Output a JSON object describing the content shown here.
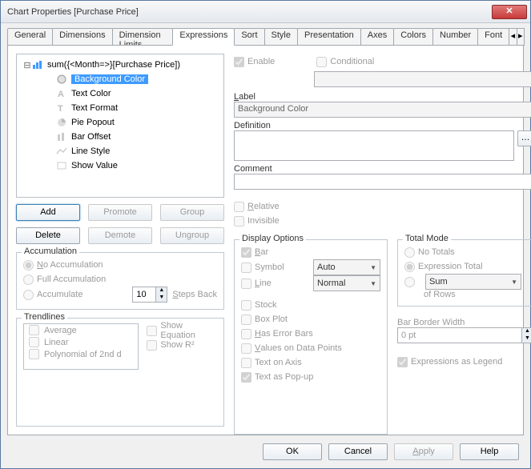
{
  "title": "Chart Properties [Purchase Price]",
  "tabs": [
    "General",
    "Dimensions",
    "Dimension Limits",
    "Expressions",
    "Sort",
    "Style",
    "Presentation",
    "Axes",
    "Colors",
    "Number",
    "Font"
  ],
  "activeTab": 3,
  "tree": {
    "root": "sum({<Month=>}[Purchase Price])",
    "children": [
      "Background Color",
      "Text Color",
      "Text Format",
      "Pie Popout",
      "Bar Offset",
      "Line Style",
      "Show Value"
    ],
    "selectedIndex": 0
  },
  "buttons": {
    "add": "Add",
    "promote": "Promote",
    "group": "Group",
    "delete": "Delete",
    "demote": "Demote",
    "ungroup": "Ungroup"
  },
  "accumulation": {
    "legend": "Accumulation",
    "noAcc": "No Accumulation",
    "fullAcc": "Full Accumulation",
    "acc": "Accumulate",
    "stepsVal": "10",
    "stepsBack": "Steps Back"
  },
  "trendlines": {
    "legend": "Trendlines",
    "items": [
      "Average",
      "Linear",
      "Polynomial of 2nd d"
    ],
    "showEq": "Show Equation",
    "showR2": "Show R²"
  },
  "topchecks": {
    "enable": "Enable",
    "conditional": "Conditional"
  },
  "labels": {
    "label": "Label",
    "definition": "Definition",
    "comment": "Comment"
  },
  "labelValue": "Background Color",
  "relInv": {
    "relative": "Relative",
    "invisible": "Invisible"
  },
  "display": {
    "legend": "Display Options",
    "bar": "Bar",
    "symbol": "Symbol",
    "line": "Line",
    "stock": "Stock",
    "boxplot": "Box Plot",
    "hasErr": "Has Error Bars",
    "vdp": "Values on Data Points",
    "toa": "Text on Axis",
    "tap": "Text as Pop-up",
    "symbolVal": "Auto",
    "lineVal": "Normal"
  },
  "totalMode": {
    "legend": "Total Mode",
    "noTotals": "No Totals",
    "exprTotal": "Expression Total",
    "sum": "Sum",
    "ofRows": "of Rows"
  },
  "barBorder": {
    "label": "Bar Border Width",
    "value": "0 pt"
  },
  "exprLegend": "Expressions as Legend",
  "footer": {
    "ok": "OK",
    "cancel": "Cancel",
    "apply": "Apply",
    "help": "Help"
  }
}
